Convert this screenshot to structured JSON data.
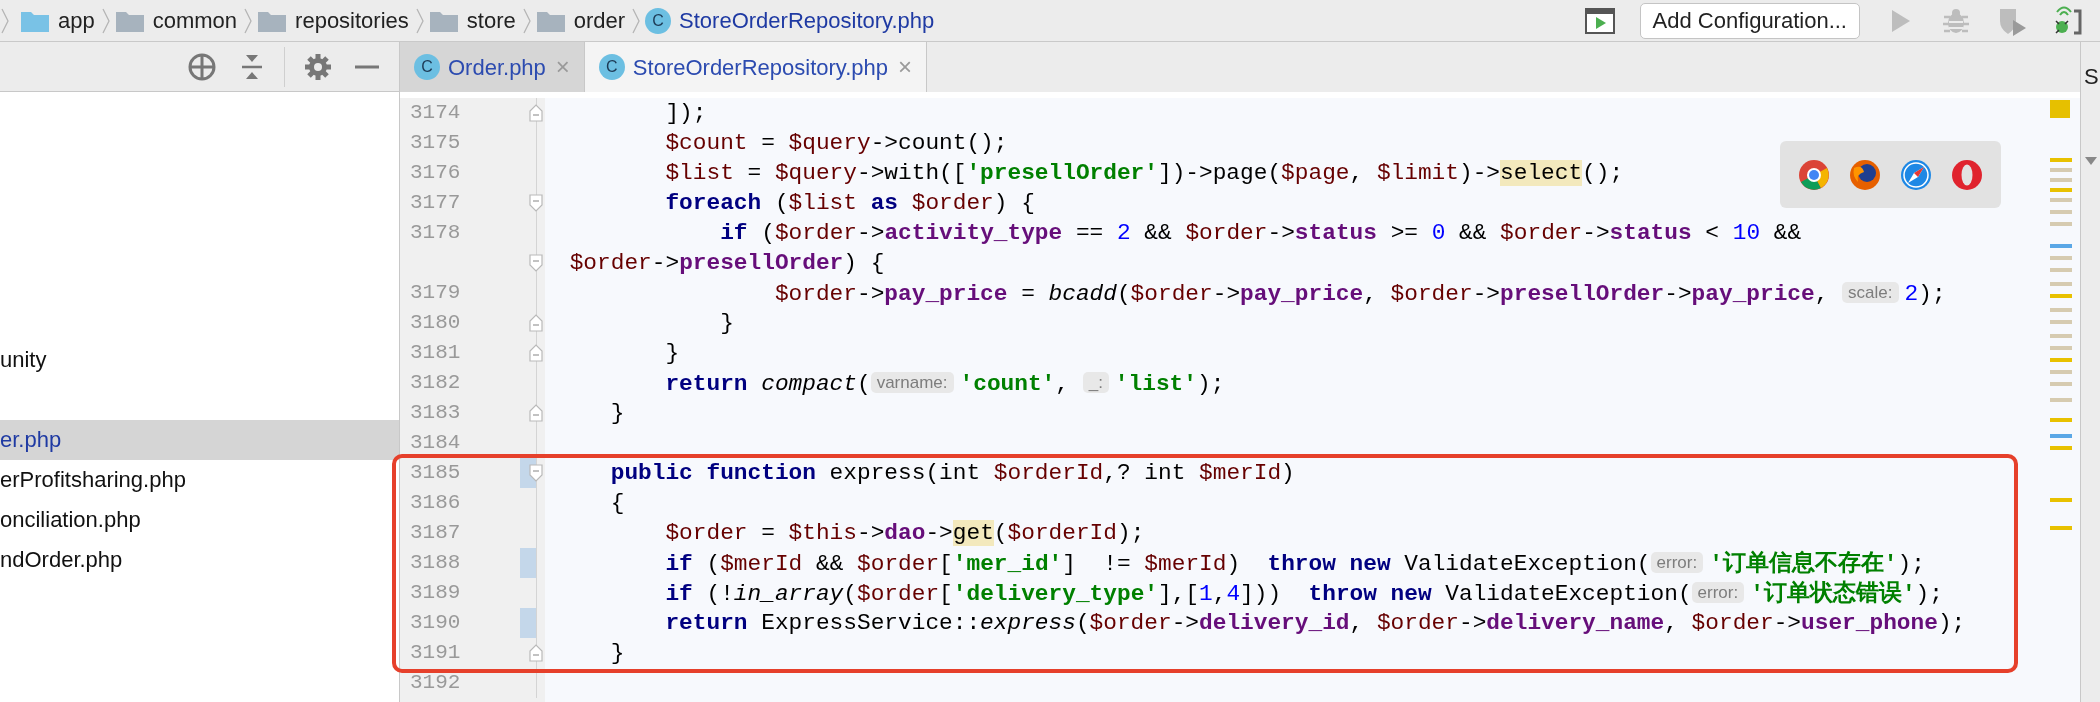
{
  "breadcrumb": [
    {
      "label": "app",
      "kind": "source_folder"
    },
    {
      "label": "common",
      "kind": "folder"
    },
    {
      "label": "repositories",
      "kind": "folder"
    },
    {
      "label": "store",
      "kind": "folder"
    },
    {
      "label": "order",
      "kind": "folder"
    },
    {
      "label": "StoreOrderRepository.php",
      "kind": "class",
      "icon_letter": "C"
    }
  ],
  "run_toolbar": {
    "config_button": "Add Configuration...",
    "buttons": [
      {
        "kind": "console",
        "disabled": false
      },
      {
        "kind": "run",
        "disabled": true
      },
      {
        "kind": "debug",
        "disabled": true
      },
      {
        "kind": "coverage",
        "disabled": true
      },
      {
        "kind": "listen",
        "disabled": false
      }
    ]
  },
  "project_tree": {
    "items": [
      {
        "label": "unity",
        "selected": false,
        "modified": false
      },
      {
        "label": "er.php",
        "selected": true,
        "modified": true
      },
      {
        "label": "erProfitsharing.php",
        "selected": false,
        "modified": false
      },
      {
        "label": "onciliation.php",
        "selected": false,
        "modified": false
      },
      {
        "label": "ndOrder.php",
        "selected": false,
        "modified": false
      }
    ]
  },
  "tabs": [
    {
      "label": "Order.php",
      "icon_letter": "C",
      "selected": false,
      "close": "×"
    },
    {
      "label": "StoreOrderRepository.php",
      "icon_letter": "C",
      "selected": true,
      "close": "×"
    }
  ],
  "editor": {
    "blocks": [
      {
        "highlighted": false,
        "lines": [
          {
            "number": "3174",
            "fold": {
              "kind": "end"
            },
            "changed": false,
            "tokens": [
              {
                "kind": "plain",
                "text": "        ]);"
              }
            ]
          },
          {
            "number": "3175",
            "changed": false,
            "tokens": [
              {
                "kind": "var",
                "text": "        $count"
              },
              {
                "kind": "plain",
                "text": " = "
              },
              {
                "kind": "var",
                "text": "$query"
              },
              {
                "kind": "plain",
                "text": "->count();"
              }
            ]
          },
          {
            "number": "3176",
            "changed": false,
            "tokens": [
              {
                "kind": "var",
                "text": "        $list"
              },
              {
                "kind": "plain",
                "text": " = "
              },
              {
                "kind": "var",
                "text": "$query"
              },
              {
                "kind": "plain",
                "text": "->with(["
              },
              {
                "kind": "string",
                "text": "'presellOrder'"
              },
              {
                "kind": "plain",
                "text": "])->page("
              },
              {
                "kind": "var",
                "text": "$page"
              },
              {
                "kind": "plain",
                "text": ", "
              },
              {
                "kind": "var",
                "text": "$limit"
              },
              {
                "kind": "plain",
                "text": ")->"
              },
              {
                "kind": "match",
                "text": "select"
              },
              {
                "kind": "plain",
                "text": "();"
              }
            ]
          },
          {
            "number": "3177",
            "fold": {
              "kind": "start"
            },
            "changed": false,
            "tokens": [
              {
                "kind": "keyword",
                "text": "        foreach"
              },
              {
                "kind": "plain",
                "text": " ("
              },
              {
                "kind": "var",
                "text": "$list"
              },
              {
                "kind": "keyword",
                "text": " as "
              },
              {
                "kind": "var",
                "text": "$order"
              },
              {
                "kind": "plain",
                "text": ") {"
              }
            ]
          },
          {
            "number": "3178",
            "changed": false,
            "tokens": [
              {
                "kind": "keyword",
                "text": "            if"
              },
              {
                "kind": "plain",
                "text": " ("
              },
              {
                "kind": "var",
                "text": "$order"
              },
              {
                "kind": "plain",
                "text": "->"
              },
              {
                "kind": "prop",
                "text": "activity_type"
              },
              {
                "kind": "plain",
                "text": " == "
              },
              {
                "kind": "number",
                "text": "2"
              },
              {
                "kind": "plain",
                "text": " && "
              },
              {
                "kind": "var",
                "text": "$order"
              },
              {
                "kind": "plain",
                "text": "->"
              },
              {
                "kind": "prop",
                "text": "status"
              },
              {
                "kind": "plain",
                "text": " >= "
              },
              {
                "kind": "number",
                "text": "0"
              },
              {
                "kind": "plain",
                "text": " && "
              },
              {
                "kind": "var",
                "text": "$order"
              },
              {
                "kind": "plain",
                "text": "->"
              },
              {
                "kind": "prop",
                "text": "status"
              },
              {
                "kind": "plain",
                "text": " < "
              },
              {
                "kind": "number",
                "text": "10"
              },
              {
                "kind": "plain",
                "text": " &&"
              }
            ],
            "wrap": {
              "fold": {
                "kind": "start"
              },
              "tokens": [
                {
                  "kind": "var",
                  "text": " $order"
                },
                {
                  "kind": "plain",
                  "text": "->"
                },
                {
                  "kind": "prop",
                  "text": "presellOrder"
                },
                {
                  "kind": "plain",
                  "text": ") {"
                }
              ]
            }
          },
          {
            "number": "3179",
            "changed": false,
            "tokens": [
              {
                "kind": "var",
                "text": "                $order"
              },
              {
                "kind": "plain",
                "text": "->"
              },
              {
                "kind": "prop",
                "text": "pay_price"
              },
              {
                "kind": "plain",
                "text": " = "
              },
              {
                "kind": "call",
                "text": "bcadd"
              },
              {
                "kind": "plain",
                "text": "("
              },
              {
                "kind": "var",
                "text": "$order"
              },
              {
                "kind": "plain",
                "text": "->"
              },
              {
                "kind": "prop",
                "text": "pay_price"
              },
              {
                "kind": "plain",
                "text": ", "
              },
              {
                "kind": "var",
                "text": "$order"
              },
              {
                "kind": "plain",
                "text": "->"
              },
              {
                "kind": "prop",
                "text": "presellOrder"
              },
              {
                "kind": "plain",
                "text": "->"
              },
              {
                "kind": "prop",
                "text": "pay_price"
              },
              {
                "kind": "plain",
                "text": ", "
              },
              {
                "kind": "hint",
                "text": "scale:"
              },
              {
                "kind": "number",
                "text": "2"
              },
              {
                "kind": "plain",
                "text": ");"
              }
            ]
          },
          {
            "number": "3180",
            "fold": {
              "kind": "end"
            },
            "changed": false,
            "tokens": [
              {
                "kind": "plain",
                "text": "            }"
              }
            ]
          },
          {
            "number": "3181",
            "fold": {
              "kind": "end"
            },
            "changed": false,
            "tokens": [
              {
                "kind": "plain",
                "text": "        }"
              }
            ]
          },
          {
            "number": "3182",
            "changed": false,
            "tokens": [
              {
                "kind": "keyword",
                "text": "        return "
              },
              {
                "kind": "call",
                "text": "compact"
              },
              {
                "kind": "plain",
                "text": "("
              },
              {
                "kind": "hint",
                "text": "varname:"
              },
              {
                "kind": "string",
                "text": "'count'"
              },
              {
                "kind": "plain",
                "text": ", "
              },
              {
                "kind": "hint",
                "text": "_:"
              },
              {
                "kind": "string",
                "text": "'list'"
              },
              {
                "kind": "plain",
                "text": ");"
              }
            ]
          },
          {
            "number": "3183",
            "fold": {
              "kind": "end"
            },
            "changed": false,
            "tokens": [
              {
                "kind": "plain",
                "text": "    }"
              }
            ]
          },
          {
            "number": "3184",
            "changed": false
          }
        ]
      },
      {
        "highlighted": true,
        "lines": [
          {
            "number": "3185",
            "fold": {
              "kind": "start"
            },
            "changed": true,
            "tokens": [
              {
                "kind": "keyword",
                "text": "    public function"
              },
              {
                "kind": "plain",
                "text": " express(int "
              },
              {
                "kind": "var",
                "text": "$orderId"
              },
              {
                "kind": "plain",
                "text": ",? int "
              },
              {
                "kind": "var",
                "text": "$merId"
              },
              {
                "kind": "plain",
                "text": ")"
              }
            ]
          },
          {
            "number": "3186",
            "changed": false,
            "tokens": [
              {
                "kind": "plain",
                "text": "    {"
              }
            ]
          },
          {
            "number": "3187",
            "changed": false,
            "tokens": [
              {
                "kind": "var",
                "text": "        $order"
              },
              {
                "kind": "plain",
                "text": " = "
              },
              {
                "kind": "var",
                "text": "$this"
              },
              {
                "kind": "plain",
                "text": "->"
              },
              {
                "kind": "prop",
                "text": "dao"
              },
              {
                "kind": "plain",
                "text": "->"
              },
              {
                "kind": "match",
                "text": "get"
              },
              {
                "kind": "plain",
                "text": "("
              },
              {
                "kind": "var",
                "text": "$orderId"
              },
              {
                "kind": "plain",
                "text": ");"
              }
            ]
          },
          {
            "number": "3188",
            "changed": true,
            "tokens": [
              {
                "kind": "keyword",
                "text": "        if"
              },
              {
                "kind": "plain",
                "text": " ("
              },
              {
                "kind": "var",
                "text": "$merId"
              },
              {
                "kind": "plain",
                "text": " && "
              },
              {
                "kind": "var",
                "text": "$order"
              },
              {
                "kind": "plain",
                "text": "["
              },
              {
                "kind": "string",
                "text": "'mer_id'"
              },
              {
                "kind": "plain",
                "text": "]  != "
              },
              {
                "kind": "var",
                "text": "$merId"
              },
              {
                "kind": "plain",
                "text": ")  "
              },
              {
                "kind": "keyword",
                "text": "throw new"
              },
              {
                "kind": "plain",
                "text": " ValidateException("
              },
              {
                "kind": "hint",
                "text": "error:"
              },
              {
                "kind": "string",
                "text": "'订单信息不存在'"
              },
              {
                "kind": "plain",
                "text": ");"
              }
            ]
          },
          {
            "number": "3189",
            "changed": false,
            "tokens": [
              {
                "kind": "keyword",
                "text": "        if"
              },
              {
                "kind": "plain",
                "text": " (!"
              },
              {
                "kind": "call",
                "text": "in_array"
              },
              {
                "kind": "plain",
                "text": "("
              },
              {
                "kind": "var",
                "text": "$order"
              },
              {
                "kind": "plain",
                "text": "["
              },
              {
                "kind": "string",
                "text": "'delivery_type'"
              },
              {
                "kind": "plain",
                "text": "],["
              },
              {
                "kind": "number",
                "text": "1"
              },
              {
                "kind": "plain",
                "text": ","
              },
              {
                "kind": "number",
                "text": "4"
              },
              {
                "kind": "plain",
                "text": "]))  "
              },
              {
                "kind": "keyword",
                "text": "throw new"
              },
              {
                "kind": "plain",
                "text": " ValidateException("
              },
              {
                "kind": "hint",
                "text": "error:"
              },
              {
                "kind": "string",
                "text": "'订单状态错误'"
              },
              {
                "kind": "plain",
                "text": ");"
              }
            ]
          },
          {
            "number": "3190",
            "changed": true,
            "tokens": [
              {
                "kind": "keyword",
                "text": "        return"
              },
              {
                "kind": "plain",
                "text": " ExpressService::"
              },
              {
                "kind": "call",
                "text": "express"
              },
              {
                "kind": "plain",
                "text": "("
              },
              {
                "kind": "var",
                "text": "$order"
              },
              {
                "kind": "plain",
                "text": "->"
              },
              {
                "kind": "prop",
                "text": "delivery_id"
              },
              {
                "kind": "plain",
                "text": ", "
              },
              {
                "kind": "var",
                "text": "$order"
              },
              {
                "kind": "plain",
                "text": "->"
              },
              {
                "kind": "prop",
                "text": "delivery_name"
              },
              {
                "kind": "plain",
                "text": ", "
              },
              {
                "kind": "var",
                "text": "$order"
              },
              {
                "kind": "plain",
                "text": "->"
              },
              {
                "kind": "prop",
                "text": "user_phone"
              },
              {
                "kind": "plain",
                "text": ");"
              }
            ]
          },
          {
            "number": "3191",
            "fold": {
              "kind": "end"
            },
            "changed": false,
            "tokens": [
              {
                "kind": "plain",
                "text": "    }"
              }
            ]
          }
        ]
      },
      {
        "highlighted": false,
        "lines": [
          {
            "number": "3192",
            "changed": false
          }
        ]
      }
    ]
  },
  "side_panel": {
    "label": "S"
  }
}
